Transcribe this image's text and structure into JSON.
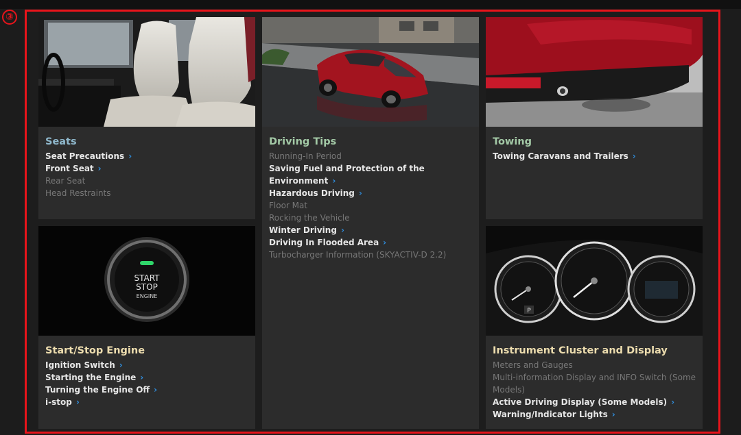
{
  "marker": "③",
  "seats": {
    "title": "Seats",
    "items": [
      {
        "label": "Seat Precautions",
        "chevron": "›",
        "active": true
      },
      {
        "label": "Front Seat",
        "chevron": "›",
        "active": true
      },
      {
        "label": "Rear Seat",
        "active": false
      },
      {
        "label": "Head Restraints",
        "active": false
      }
    ]
  },
  "driving": {
    "title": "Driving Tips",
    "items": [
      {
        "label": "Running-In Period",
        "active": false
      },
      {
        "label": "Saving Fuel and Protection of the Environment",
        "chevron": "›",
        "active": true
      },
      {
        "label": "Hazardous Driving",
        "chevron": "›",
        "active": true
      },
      {
        "label": "Floor Mat",
        "active": false
      },
      {
        "label": "Rocking the Vehicle",
        "active": false
      },
      {
        "label": "Winter Driving",
        "chevron": "›",
        "active": true
      },
      {
        "label": "Driving In Flooded Area",
        "chevron": "›",
        "active": true
      },
      {
        "label": "Turbocharger Information (SKYACTIV-D 2.2)",
        "active": false
      }
    ]
  },
  "towing": {
    "title": "Towing",
    "items": [
      {
        "label": "Towing Caravans and Trailers",
        "chevron": "›",
        "active": true
      }
    ]
  },
  "startstop": {
    "title": "Start/Stop Engine",
    "button_text": {
      "line1": "START",
      "line2": "STOP",
      "line3": "ENGINE"
    },
    "items": [
      {
        "label": "Ignition Switch",
        "chevron": "›",
        "active": true
      },
      {
        "label": "Starting the Engine",
        "chevron": "›",
        "active": true
      },
      {
        "label": "Turning the Engine Off",
        "chevron": "›",
        "active": true
      },
      {
        "label": "i-stop",
        "chevron": "›",
        "active": true
      }
    ]
  },
  "cluster": {
    "title": "Instrument Cluster and Display",
    "gear_label": "P",
    "items": [
      {
        "label": "Meters and Gauges",
        "active": false
      },
      {
        "label": "Multi-information Display and INFO Switch (Some Models)",
        "active": false
      },
      {
        "label": "Active Driving Display (Some Models)",
        "chevron": "›",
        "active": true
      },
      {
        "label": "Warning/Indicator Lights",
        "chevron": "›",
        "active": true
      }
    ]
  },
  "colors": {
    "frame": "#e8141b",
    "panel": "#2c2c2c",
    "chevron": "#2f8fe0",
    "title_blue": "#8fb8cc",
    "title_green": "#a3c9a6",
    "title_cream": "#ecdcae"
  }
}
